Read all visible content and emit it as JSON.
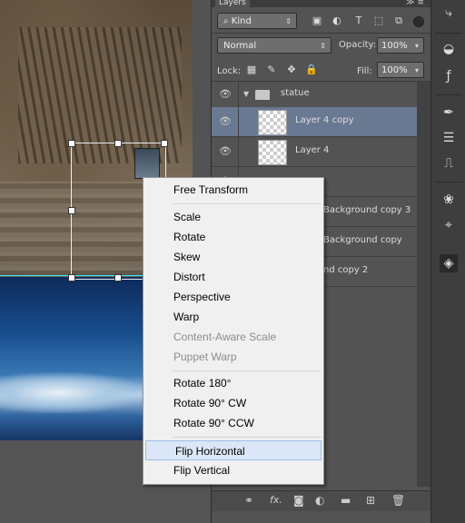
{
  "panel": {
    "tab_label": "Layers",
    "menu_glyph": "≫ ≡",
    "kind_select": "Kind",
    "blend_mode": "Normal",
    "opacity_label": "Opacity:",
    "opacity_value": "100%",
    "lock_label": "Lock:",
    "fill_label": "Fill:",
    "fill_value": "100%",
    "filter_icons": [
      "image-icon",
      "circle-half-icon",
      "type-icon",
      "shape-icon",
      "smart-object-icon"
    ]
  },
  "layers": [
    {
      "name": "statue",
      "type": "group",
      "active": false
    },
    {
      "name": "Layer 4 copy",
      "type": "layer",
      "active": true
    },
    {
      "name": "Layer 4",
      "type": "layer",
      "active": false
    },
    {
      "name": "Background copy 3",
      "visible_fragment": "Background copy 3",
      "type": "layer",
      "active": false
    },
    {
      "name": "Background copy",
      "visible_fragment": "Background copy",
      "type": "layer",
      "active": false
    },
    {
      "name": "nd copy 2",
      "visible_fragment": "nd copy 2",
      "type": "layer",
      "active": false
    }
  ],
  "context_menu": {
    "items": [
      {
        "label": "Free Transform",
        "enabled": true
      },
      {
        "label": "Scale",
        "enabled": true
      },
      {
        "label": "Rotate",
        "enabled": true
      },
      {
        "label": "Skew",
        "enabled": true
      },
      {
        "label": "Distort",
        "enabled": true
      },
      {
        "label": "Perspective",
        "enabled": true
      },
      {
        "label": "Warp",
        "enabled": true
      },
      {
        "label": "Content-Aware Scale",
        "enabled": false
      },
      {
        "label": "Puppet Warp",
        "enabled": false
      },
      {
        "label": "Rotate 180°",
        "enabled": true
      },
      {
        "label": "Rotate 90° CW",
        "enabled": true
      },
      {
        "label": "Rotate 90° CCW",
        "enabled": true
      },
      {
        "label": "Flip Horizontal",
        "enabled": true,
        "highlighted": true
      },
      {
        "label": "Flip Vertical",
        "enabled": true
      }
    ]
  },
  "footer_icons": [
    "link-icon",
    "fx-icon",
    "mask-icon",
    "adjustment-icon",
    "folder-icon",
    "new-layer-icon",
    "trash-icon"
  ],
  "footer_labels": {
    "fx": "fx."
  },
  "tools": [
    "history-icon",
    "color-icon",
    "styles-icon",
    "brush-icon",
    "properties-icon",
    "clone-icon",
    "channels-icon",
    "paths-icon",
    "layers-icon"
  ],
  "colors": {
    "active_layer": "#6a7992",
    "menu_highlight": "#dbe7f6",
    "guide": "#2ee6e6"
  }
}
